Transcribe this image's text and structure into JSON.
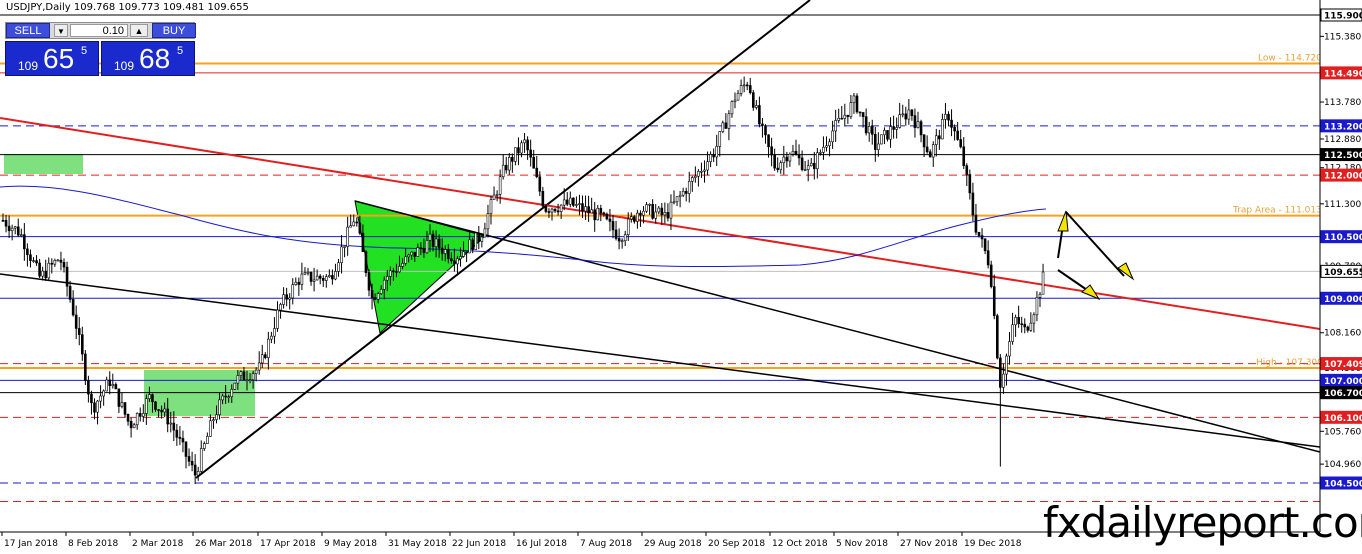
{
  "window": {
    "title": "USDJPY,Daily  109.768 109.773 109.481 109.655"
  },
  "trade_panel": {
    "sell_label": "SELL",
    "buy_label": "BUY",
    "lot": "0.10",
    "sell_prefix": "109",
    "sell_big": "65",
    "sell_sup": "5",
    "buy_prefix": "109",
    "buy_big": "68",
    "buy_sup": "5"
  },
  "watermark": "fxdailyreport.com",
  "chart_data": {
    "type": "candlestick",
    "symbol": "USDJPY",
    "timeframe": "Daily",
    "ohlc": {
      "open": 109.768,
      "high": 109.773,
      "low": 109.481,
      "close": 109.655
    },
    "ylim": [
      104.0,
      116.0
    ],
    "x_tick_labels": [
      "17 Jan 2018",
      "8 Feb 2018",
      "2 Mar 2018",
      "26 Mar 2018",
      "17 Apr 2018",
      "9 May 2018",
      "31 May 2018",
      "22 Jun 2018",
      "16 Jul 2018",
      "7 Aug 2018",
      "29 Aug 2018",
      "20 Sep 2018",
      "12 Oct 2018",
      "5 Nov 2018",
      "27 Nov 2018",
      "19 Dec 2018"
    ],
    "y_tick_labels": [
      "115.900",
      "115.380",
      "114.720",
      "114.490",
      "113.780",
      "113.200",
      "112.880",
      "112.500",
      "112.180",
      "112.000",
      "111.300",
      "111.013",
      "110.500",
      "109.780",
      "109.655",
      "109.000",
      "108.160",
      "107.409",
      "107.300",
      "107.000",
      "106.700",
      "106.100",
      "105.760",
      "104.960",
      "104.500"
    ],
    "levels": [
      {
        "price": 115.9,
        "label": "115.900",
        "style": "solid",
        "color": "#000000",
        "label_bg": "#ffffff",
        "label_fg": "#000000"
      },
      {
        "price": 114.72,
        "label": "",
        "style": "solid",
        "color": "#f7a21b",
        "annotation": "Low - 114.720"
      },
      {
        "price": 114.49,
        "label": "114.490",
        "style": "solid",
        "color": "#e02020",
        "label_bg": "#e02020",
        "label_fg": "#ffffff"
      },
      {
        "price": 113.2,
        "label": "113.200",
        "style": "dashed",
        "color": "#1a1acc",
        "label_bg": "#1a1acc",
        "label_fg": "#ffffff"
      },
      {
        "price": 112.5,
        "label": "112.500",
        "style": "solid",
        "color": "#000000",
        "label_bg": "#000000",
        "label_fg": "#ffffff"
      },
      {
        "price": 112.0,
        "label": "112.000",
        "style": "dashed",
        "color": "#e02020",
        "label_bg": "#e02020",
        "label_fg": "#ffffff"
      },
      {
        "price": 111.013,
        "label": "",
        "style": "solid",
        "color": "#f7a21b",
        "annotation": "Trap Area - 111.013"
      },
      {
        "price": 110.5,
        "label": "110.500",
        "style": "solid",
        "color": "#1a1acc",
        "label_bg": "#1a1acc",
        "label_fg": "#ffffff"
      },
      {
        "price": 109.655,
        "label": "109.655",
        "style": "solid",
        "color": "#c0c0c0",
        "label_bg": "#ffffff",
        "label_fg": "#000000"
      },
      {
        "price": 109.0,
        "label": "109.000",
        "style": "solid",
        "color": "#1a1acc",
        "label_bg": "#1a1acc",
        "label_fg": "#ffffff"
      },
      {
        "price": 107.409,
        "label": "107.409",
        "style": "dashed",
        "color": "#e02020",
        "label_bg": "#e02020",
        "label_fg": "#ffffff"
      },
      {
        "price": 107.3,
        "label": "",
        "style": "solid",
        "color": "#f7a21b",
        "annotation": "High - 107.300"
      },
      {
        "price": 107.0,
        "label": "107.000",
        "style": "solid",
        "color": "#1a1acc",
        "label_bg": "#1a1acc",
        "label_fg": "#ffffff"
      },
      {
        "price": 106.7,
        "label": "106.700",
        "style": "solid",
        "color": "#000000",
        "label_bg": "#000000",
        "label_fg": "#ffffff"
      },
      {
        "price": 106.1,
        "label": "106.100",
        "style": "dashed",
        "color": "#e02020",
        "label_bg": "#e02020",
        "label_fg": "#ffffff"
      },
      {
        "price": 104.5,
        "label": "104.500",
        "style": "dashed",
        "color": "#1a1acc",
        "label_bg": "#1a1acc",
        "label_fg": "#ffffff"
      },
      {
        "price": 104.05,
        "label": "",
        "style": "dashed",
        "color": "#e02020"
      }
    ],
    "axis_ticks": [
      {
        "price": 115.38,
        "label": "115.380"
      },
      {
        "price": 113.78,
        "label": "113.780"
      },
      {
        "price": 112.88,
        "label": "112.880"
      },
      {
        "price": 112.18,
        "label": "112.180"
      },
      {
        "price": 111.3,
        "label": "111.300"
      },
      {
        "price": 109.78,
        "label": "109.780"
      },
      {
        "price": 108.16,
        "label": "108.160"
      },
      {
        "price": 107.3,
        "label": "107.300"
      },
      {
        "price": 105.76,
        "label": "105.760"
      },
      {
        "price": 104.96,
        "label": "104.960"
      }
    ],
    "zones": [
      {
        "price_top": 112.55,
        "price_bottom": 112.05,
        "color": "#7ee07e"
      },
      {
        "price_top": 107.3,
        "price_bottom": 106.2,
        "color": "#7ee07e"
      }
    ],
    "grid": false,
    "legend": "none"
  }
}
